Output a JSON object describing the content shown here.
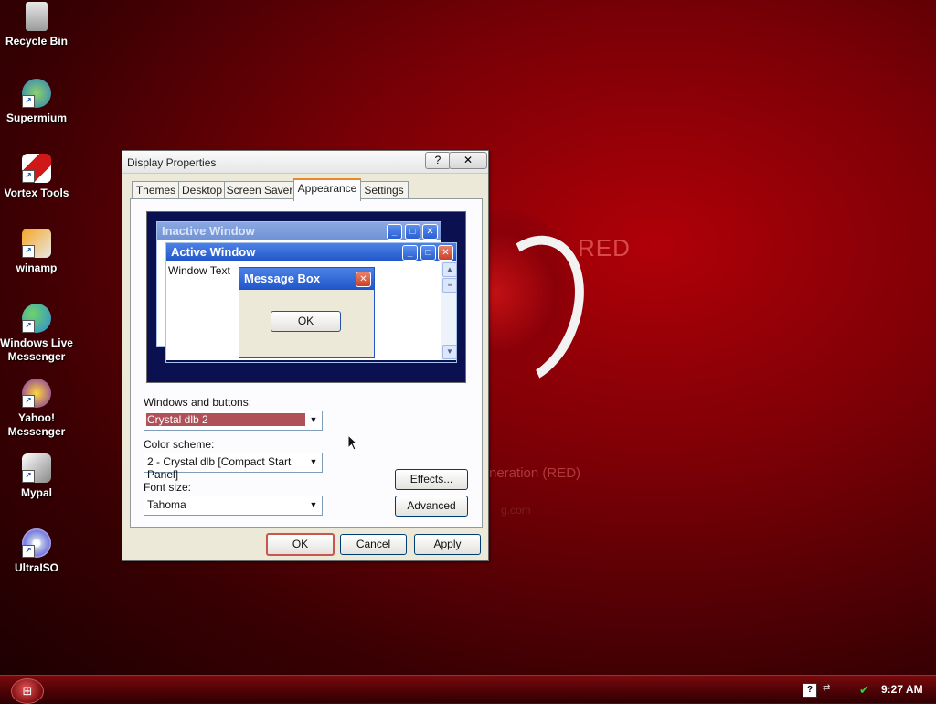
{
  "wallpaper": {
    "brand_text": "RED",
    "subtitle_text": "neration (RED)",
    "site_text": "g.com"
  },
  "desktop_icons": [
    {
      "label": "Recycle Bin",
      "icon": "recycle-bin-icon"
    },
    {
      "label": "Supermium",
      "icon": "supermium-icon"
    },
    {
      "label": "Vortex Tools",
      "icon": "vortex-tools-icon"
    },
    {
      "label": "winamp",
      "icon": "winamp-icon"
    },
    {
      "label": "Windows Live Messenger",
      "icon": "windows-live-messenger-icon"
    },
    {
      "label": "Yahoo! Messenger",
      "icon": "yahoo-messenger-icon"
    },
    {
      "label": "Mypal",
      "icon": "mypal-icon"
    },
    {
      "label": "UltraISO",
      "icon": "ultraiso-icon"
    }
  ],
  "dialog": {
    "title": "Display Properties",
    "help_glyph": "?",
    "close_glyph": "✕",
    "tabs": [
      {
        "label": "Themes",
        "active": false
      },
      {
        "label": "Desktop",
        "active": false
      },
      {
        "label": "Screen Saver",
        "active": false
      },
      {
        "label": "Appearance",
        "active": true
      },
      {
        "label": "Settings",
        "active": false
      }
    ],
    "preview": {
      "inactive_window_title": "Inactive Window",
      "active_window_title": "Active Window",
      "window_text": "Window Text",
      "message_box_title": "Message Box",
      "message_box_ok": "OK"
    },
    "windows_and_buttons_label": "Windows and buttons:",
    "windows_and_buttons_value": "Crystal dlb 2",
    "color_scheme_label": "Color scheme:",
    "color_scheme_value": "2 - Crystal dlb [Compact Start Panel]",
    "font_size_label": "Font size:",
    "font_size_value": "Tahoma",
    "effects_button": "Effects...",
    "advanced_button": "Advanced",
    "ok_button": "OK",
    "cancel_button": "Cancel",
    "apply_button": "Apply"
  },
  "taskbar": {
    "clock": "9:27 AM"
  },
  "colors": {
    "accent": "#1f55c8",
    "wallpaper": "#8a0008",
    "selection": "#b05058"
  }
}
